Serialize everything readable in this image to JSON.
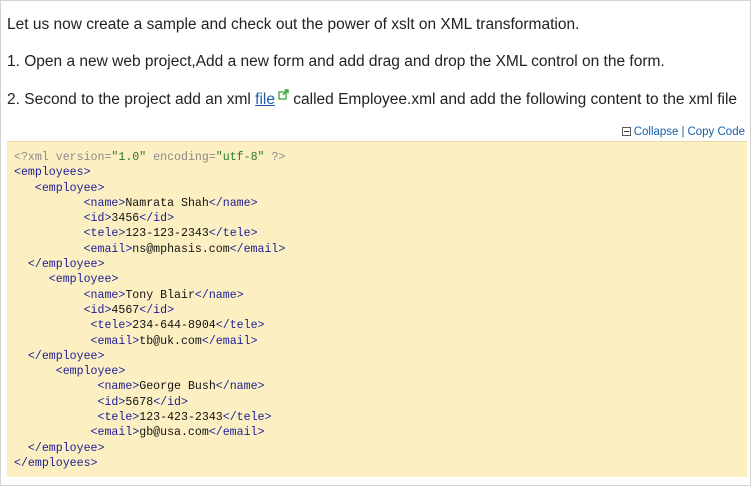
{
  "intro": {
    "line1": "Let us now create a sample and check out the power of xslt on XML transformation.",
    "line2": "1. Open a new web project,Add a new form and add drag and drop the XML control on the form.",
    "line3_prefix": "2. Second to the project add an xml ",
    "line3_link": "file",
    "line3_suffix": " called Employee.xml and add the following content to the xml file",
    "link_icon": "external-link-icon"
  },
  "toolbar": {
    "collapse_icon": "collapse-box-icon",
    "collapse_label": "Collapse",
    "separator": "|",
    "copy_label": "Copy Code"
  },
  "colors": {
    "code_background": "#fcf0c3",
    "tag": "#1c1c96",
    "attribute_value": "#2b7a2b",
    "processing_instruction": "#8a8a8a",
    "link": "#1a5ea8"
  },
  "code_lines": [
    [
      {
        "t": "pi",
        "s": "<?xml version="
      },
      {
        "t": "val",
        "s": "\"1.0\""
      },
      {
        "t": "pi",
        "s": " encoding="
      },
      {
        "t": "val",
        "s": "\"utf-8\""
      },
      {
        "t": "pi",
        "s": " ?>"
      }
    ],
    [
      {
        "t": "tag",
        "s": "<employees>"
      }
    ],
    [
      {
        "t": "text",
        "s": "   "
      },
      {
        "t": "tag",
        "s": "<employee>"
      }
    ],
    [
      {
        "t": "text",
        "s": "          "
      },
      {
        "t": "tag",
        "s": "<name>"
      },
      {
        "t": "text",
        "s": "Namrata Shah"
      },
      {
        "t": "tag",
        "s": "</name>"
      }
    ],
    [
      {
        "t": "text",
        "s": "          "
      },
      {
        "t": "tag",
        "s": "<id>"
      },
      {
        "t": "text",
        "s": "3456"
      },
      {
        "t": "tag",
        "s": "</id>"
      }
    ],
    [
      {
        "t": "text",
        "s": "          "
      },
      {
        "t": "tag",
        "s": "<tele>"
      },
      {
        "t": "text",
        "s": "123-123-2343"
      },
      {
        "t": "tag",
        "s": "</tele>"
      }
    ],
    [
      {
        "t": "text",
        "s": "          "
      },
      {
        "t": "tag",
        "s": "<email>"
      },
      {
        "t": "text",
        "s": "ns@mphasis.com"
      },
      {
        "t": "tag",
        "s": "</email>"
      }
    ],
    [
      {
        "t": "text",
        "s": "  "
      },
      {
        "t": "tag",
        "s": "</employee>"
      }
    ],
    [
      {
        "t": "text",
        "s": "     "
      },
      {
        "t": "tag",
        "s": "<employee>"
      }
    ],
    [
      {
        "t": "text",
        "s": "          "
      },
      {
        "t": "tag",
        "s": "<name>"
      },
      {
        "t": "text",
        "s": "Tony Blair"
      },
      {
        "t": "tag",
        "s": "</name>"
      }
    ],
    [
      {
        "t": "text",
        "s": "          "
      },
      {
        "t": "tag",
        "s": "<id>"
      },
      {
        "t": "text",
        "s": "4567"
      },
      {
        "t": "tag",
        "s": "</id>"
      }
    ],
    [
      {
        "t": "text",
        "s": "           "
      },
      {
        "t": "tag",
        "s": "<tele>"
      },
      {
        "t": "text",
        "s": "234-644-8904"
      },
      {
        "t": "tag",
        "s": "</tele>"
      }
    ],
    [
      {
        "t": "text",
        "s": "           "
      },
      {
        "t": "tag",
        "s": "<email>"
      },
      {
        "t": "text",
        "s": "tb@uk.com"
      },
      {
        "t": "tag",
        "s": "</email>"
      }
    ],
    [
      {
        "t": "text",
        "s": "  "
      },
      {
        "t": "tag",
        "s": "</employee>"
      }
    ],
    [
      {
        "t": "text",
        "s": "      "
      },
      {
        "t": "tag",
        "s": "<employee>"
      }
    ],
    [
      {
        "t": "text",
        "s": "            "
      },
      {
        "t": "tag",
        "s": "<name>"
      },
      {
        "t": "text",
        "s": "George Bush"
      },
      {
        "t": "tag",
        "s": "</name>"
      }
    ],
    [
      {
        "t": "text",
        "s": "            "
      },
      {
        "t": "tag",
        "s": "<id>"
      },
      {
        "t": "text",
        "s": "5678"
      },
      {
        "t": "tag",
        "s": "</id>"
      }
    ],
    [
      {
        "t": "text",
        "s": "            "
      },
      {
        "t": "tag",
        "s": "<tele>"
      },
      {
        "t": "text",
        "s": "123-423-2343"
      },
      {
        "t": "tag",
        "s": "</tele>"
      }
    ],
    [
      {
        "t": "text",
        "s": "           "
      },
      {
        "t": "tag",
        "s": "<email>"
      },
      {
        "t": "text",
        "s": "gb@usa.com"
      },
      {
        "t": "tag",
        "s": "</email>"
      }
    ],
    [
      {
        "t": "text",
        "s": "  "
      },
      {
        "t": "tag",
        "s": "</employee>"
      }
    ],
    [
      {
        "t": "tag",
        "s": "</employees>"
      }
    ]
  ]
}
